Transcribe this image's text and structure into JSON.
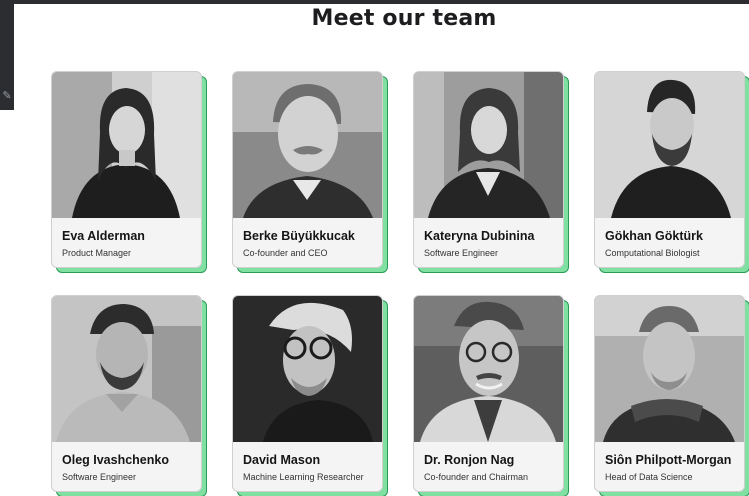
{
  "page": {
    "title": "Meet our team"
  },
  "team": [
    {
      "name": "Eva Alderman",
      "role": "Product Manager",
      "photo": "portrait-photo"
    },
    {
      "name": "Berke Büyükkucak",
      "role": "Co-founder and CEO",
      "photo": "portrait-photo"
    },
    {
      "name": "Kateryna Dubinina",
      "role": "Software Engineer",
      "photo": "portrait-photo"
    },
    {
      "name": "Gökhan Göktürk",
      "role": "Computational Biologist",
      "photo": "portrait-photo"
    },
    {
      "name": "Oleg Ivashchenko",
      "role": "Software Engineer",
      "photo": "portrait-photo"
    },
    {
      "name": "David Mason",
      "role": "Machine Learning Researcher",
      "photo": "portrait-photo"
    },
    {
      "name": "Dr. Ronjon Nag",
      "role": "Co-founder and Chairman",
      "photo": "portrait-photo"
    },
    {
      "name": "Siôn Philpott-Morgan",
      "role": "Head of Data Science",
      "photo": "portrait-photo"
    }
  ],
  "colors": {
    "card_accent": "#7fe0a2",
    "card_background": "#f4f4f4",
    "title_text": "#1d1d1f"
  }
}
